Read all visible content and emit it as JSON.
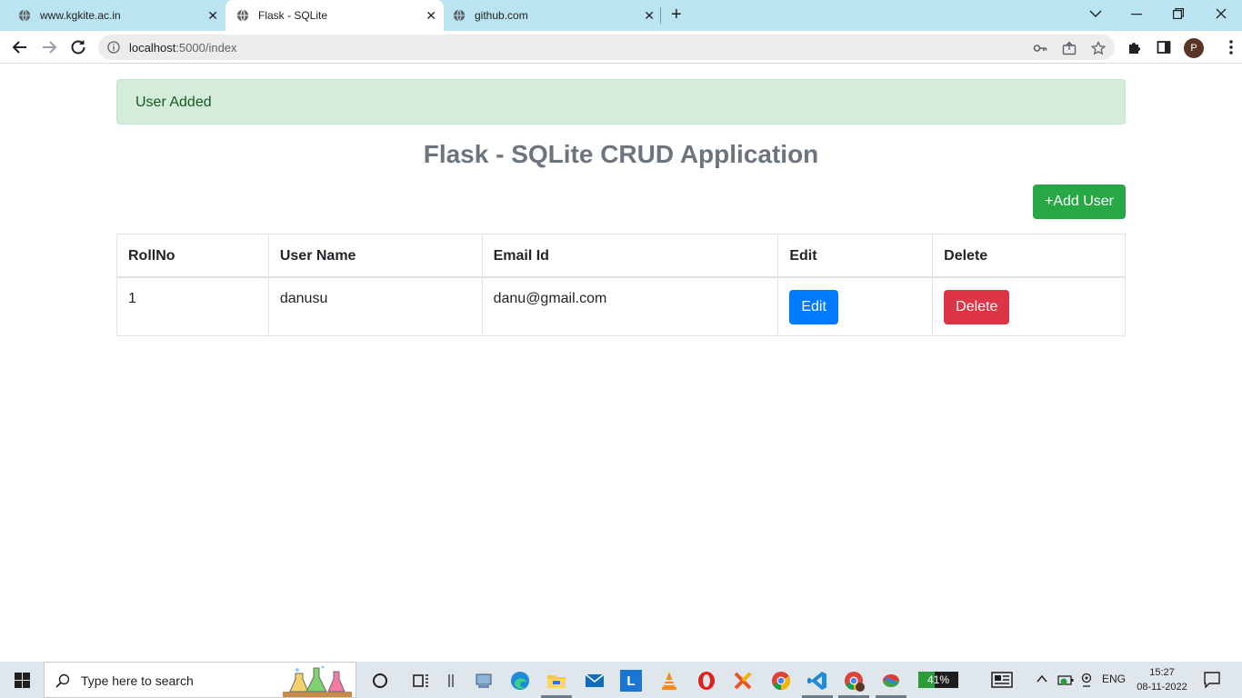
{
  "browser": {
    "tabs": [
      {
        "title": "www.kgkite.ac.in",
        "active": false
      },
      {
        "title": "Flask - SQLite",
        "active": true
      },
      {
        "title": "github.com",
        "active": false
      }
    ],
    "url_host": "localhost",
    "url_rest": ":5000/index",
    "profile_initial": "P"
  },
  "page": {
    "alert_text": "User Added",
    "title": "Flask - SQLite CRUD Application",
    "add_button": "+Add User",
    "table": {
      "headers": [
        "RollNo",
        "User Name",
        "Email Id",
        "Edit",
        "Delete"
      ],
      "rows": [
        {
          "roll": "1",
          "name": "danusu",
          "email": "danu@gmail.com",
          "edit_label": "Edit",
          "delete_label": "Delete"
        }
      ]
    }
  },
  "taskbar": {
    "search_placeholder": "Type here to search",
    "battery_level": 41,
    "battery_text": "41%",
    "language": "ENG",
    "time": "15:27",
    "date": "08-11-2022"
  },
  "colors": {
    "success": "#28a745",
    "primary": "#007bff",
    "danger": "#dc3545",
    "alert_bg": "#d4edda",
    "tabstrip": "#b9e4f0"
  }
}
